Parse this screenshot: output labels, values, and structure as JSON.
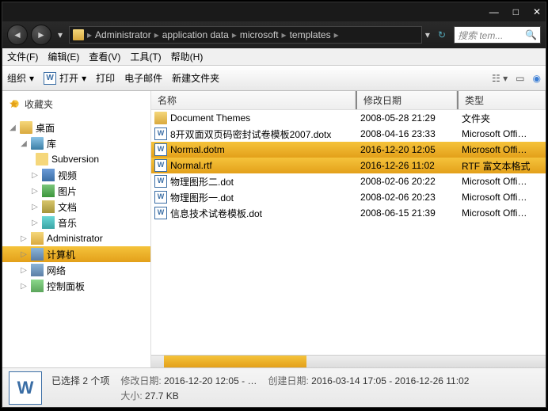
{
  "titlebar": {
    "min": "—",
    "max": "□",
    "close": "✕"
  },
  "nav": {
    "path": [
      "Administrator",
      "application data",
      "microsoft",
      "templates"
    ],
    "search_placeholder": "搜索 tem..."
  },
  "menu": {
    "file": "文件(F)",
    "edit": "编辑(E)",
    "view": "查看(V)",
    "tools": "工具(T)",
    "help": "帮助(H)"
  },
  "toolbar": {
    "org": "组织",
    "open": "打开",
    "print": "打印",
    "email": "电子邮件",
    "new": "新建文件夹"
  },
  "sidebar": {
    "fav": "收藏夹",
    "desktop": "桌面",
    "lib": "库",
    "svn": "Subversion",
    "video": "视频",
    "pic": "图片",
    "doc": "文档",
    "music": "音乐",
    "admin": "Administrator",
    "computer": "计算机",
    "network": "网络",
    "control": "控制面板"
  },
  "columns": {
    "name": "名称",
    "date": "修改日期",
    "type": "类型"
  },
  "files": [
    {
      "icon": "fold",
      "name": "Document Themes",
      "date": "2008-05-28 21:29",
      "type": "文件夹",
      "sel": false
    },
    {
      "icon": "word",
      "name": "8开双面双页码密封试卷模板2007.dotx",
      "date": "2008-04-16 23:33",
      "type": "Microsoft Offi…",
      "sel": false
    },
    {
      "icon": "word",
      "name": "Normal.dotm",
      "date": "2016-12-20 12:05",
      "type": "Microsoft Offi…",
      "sel": true
    },
    {
      "icon": "word",
      "name": "Normal.rtf",
      "date": "2016-12-26 11:02",
      "type": "RTF 富文本格式",
      "sel": true
    },
    {
      "icon": "word",
      "name": "物理图形二.dot",
      "date": "2008-02-06 20:22",
      "type": "Microsoft Offi…",
      "sel": false
    },
    {
      "icon": "word",
      "name": "物理图形一.dot",
      "date": "2008-02-06 20:23",
      "type": "Microsoft Offi…",
      "sel": false
    },
    {
      "icon": "word",
      "name": "信息技术试卷模板.dot",
      "date": "2008-06-15 21:39",
      "type": "Microsoft Offi…",
      "sel": false
    }
  ],
  "status": {
    "selected": "已选择 2 个项",
    "mod_label": "修改日期:",
    "mod_val": "2016-12-20 12:05 - …",
    "create_label": "创建日期:",
    "create_val": "2016-03-14 17:05 - 2016-12-26 11:02",
    "size_label": "大小:",
    "size_val": "27.7 KB"
  }
}
